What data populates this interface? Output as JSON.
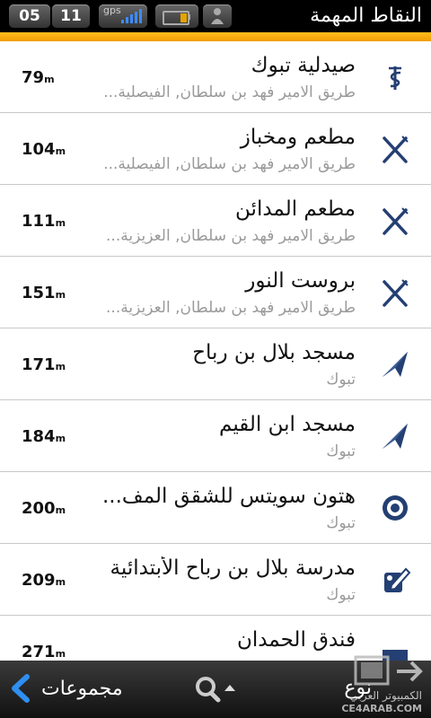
{
  "status": {
    "hour": "05",
    "minute": "11",
    "gps_label": "gps",
    "battery_level": 0.3,
    "title": "النقاط المهمة"
  },
  "colors": {
    "accent": "#f7a800",
    "icon": "#243f73",
    "bar": "#000000"
  },
  "items": [
    {
      "name": "صيدلية تبوك",
      "address": "طريق الامير فهد بن سلطان,  الفيصلية...",
      "distance": "79",
      "unit": "m",
      "icon": "pharmacy-icon"
    },
    {
      "name": "مطعم ومخباز",
      "address": "طريق الامير فهد بن سلطان,  الفيصلية...",
      "distance": "104",
      "unit": "m",
      "icon": "restaurant-icon"
    },
    {
      "name": "مطعم المدائن",
      "address": "طريق الامير فهد بن سلطان,  العزيزية...",
      "distance": "111",
      "unit": "m",
      "icon": "restaurant-icon"
    },
    {
      "name": "بروست النور",
      "address": "طريق الامير فهد بن سلطان,  العزيزية...",
      "distance": "151",
      "unit": "m",
      "icon": "restaurant-icon"
    },
    {
      "name": "مسجد بلال بن رباح",
      "address": "تبوك",
      "distance": "171",
      "unit": "m",
      "icon": "mosque-icon"
    },
    {
      "name": "مسجد ابن القيم",
      "address": "تبوك",
      "distance": "184",
      "unit": "m",
      "icon": "mosque-icon"
    },
    {
      "name": "هتون سويتس للشقق المف...",
      "address": "تبوك",
      "distance": "200",
      "unit": "m",
      "icon": "target-icon"
    },
    {
      "name": "مدرسة بلال بن رباح الأبتدائية",
      "address": "تبوك",
      "distance": "209",
      "unit": "m",
      "icon": "school-icon"
    },
    {
      "name": "فندق الحمدان",
      "address": "",
      "distance": "271",
      "unit": "m",
      "icon": "hotel-icon"
    }
  ],
  "bottom": {
    "groups_label": "مجموعات",
    "right_label": "نوع"
  },
  "watermark": {
    "line1": "الكمبيوتر العربي",
    "line2": "CE4ARAB.COM"
  }
}
